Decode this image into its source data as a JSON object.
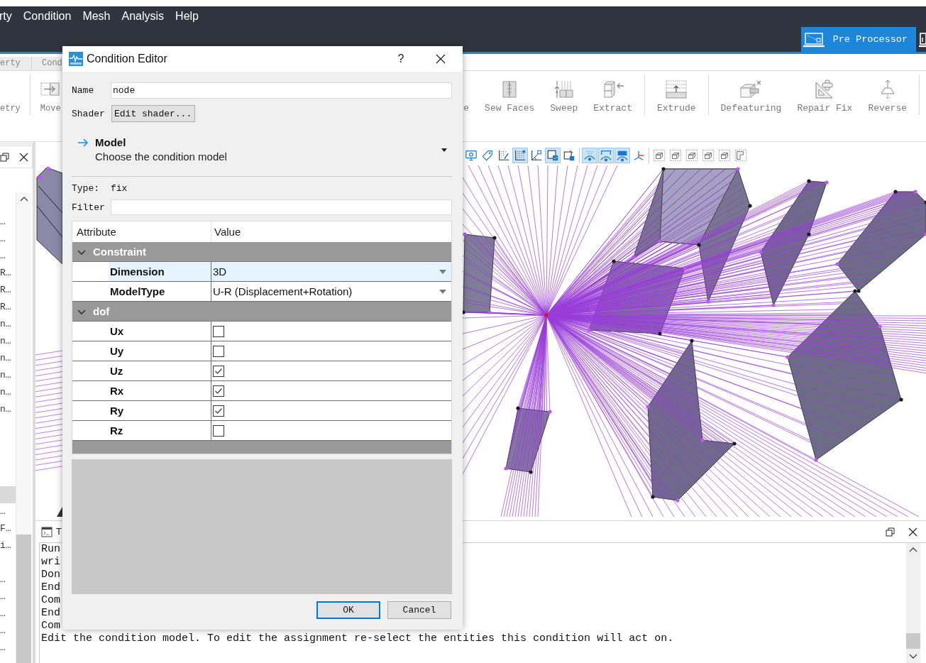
{
  "menu_bar": {
    "items": [
      "rty",
      "Condition",
      "Mesh",
      "Analysis",
      "Help"
    ]
  },
  "perspectives": [
    {
      "label": "Pre Processor",
      "selected": true
    },
    {
      "selected": false
    }
  ],
  "panel_tabs": [
    "erty",
    "Cond"
  ],
  "ribbon": {
    "left_groups": [
      [
        "etry"
      ],
      [
        "Move"
      ]
    ],
    "right_groups": [
      [
        "e",
        "Sew Faces",
        "Sweep",
        "Extract"
      ],
      [
        "Extrude"
      ],
      [
        "Defeaturing",
        "Repair Fix",
        "Reverse"
      ]
    ]
  },
  "tree_panel": {
    "rows": [
      {
        "label": "…",
        "selected": false
      },
      {
        "label": "…",
        "selected": false
      },
      {
        "label": "…",
        "selected": false
      },
      {
        "label": "R…",
        "selected": false
      },
      {
        "label": "R…",
        "selected": false
      },
      {
        "label": "R…",
        "selected": false
      },
      {
        "label": "n…",
        "selected": false
      },
      {
        "label": "n…",
        "selected": false
      },
      {
        "label": "n…",
        "selected": false
      },
      {
        "label": "n…",
        "selected": false
      },
      {
        "label": "n…",
        "selected": false
      },
      {
        "label": "n…",
        "selected": false
      },
      {
        "selected": false
      },
      {
        "selected": false
      },
      {
        "selected": false
      },
      {
        "selected": false
      },
      {
        "selected": true
      },
      {
        "label": "…",
        "selected": false
      },
      {
        "label": "F…",
        "selected": false
      },
      {
        "label": "i…",
        "selected": false
      },
      {
        "selected": false
      },
      {
        "label": "…",
        "selected": false
      },
      {
        "label": "…",
        "selected": false
      },
      {
        "label": "…",
        "selected": false
      },
      {
        "label": "…",
        "selected": false
      },
      {
        "label": "…",
        "selected": false
      }
    ]
  },
  "view_toolbar": [
    [
      {
        "on": false
      },
      {
        "on": false
      },
      {
        "on": false
      },
      {
        "on": true
      },
      {
        "on": false
      },
      {
        "on": true
      },
      {
        "on": false
      }
    ],
    [
      {
        "on": true
      },
      {
        "on": true
      },
      {
        "on": true
      },
      {
        "on": false
      }
    ],
    [
      {
        "on": false
      },
      {
        "on": false
      },
      {
        "on": false
      },
      {
        "on": false
      },
      {
        "on": false
      },
      {
        "on": false
      }
    ]
  ],
  "console": {
    "title": "T",
    "lines": [
      "Run",
      "wri",
      "Don",
      "End",
      "Com",
      "End",
      "Com",
      "Edit the condition model. To edit the assignment re-select the entities this condition will act on."
    ]
  },
  "dialog": {
    "title": "Condition Editor",
    "help_button": "?",
    "name_label": "Name",
    "name_value": "node",
    "shader_label": "Shader",
    "shader_button": "Edit shader...",
    "model": {
      "title": "Model",
      "subtitle": "Choose the condition model"
    },
    "type_label": "Type:",
    "type_value": "fix",
    "filter_label": "Filter",
    "table": {
      "columns": [
        "Attribute",
        "Value"
      ],
      "groups": [
        {
          "name": "Constraint",
          "expanded": true,
          "rows": [
            {
              "name": "Dimension",
              "kind": "combo",
              "value": "3D",
              "selected": true
            },
            {
              "name": "ModelType",
              "kind": "combo",
              "value": "U-R (Displacement+Rotation)",
              "selected": false
            }
          ]
        },
        {
          "name": "dof",
          "expanded": true,
          "rows": [
            {
              "name": "Ux",
              "kind": "checkbox",
              "checked": false,
              "selected": false
            },
            {
              "name": "Uy",
              "kind": "checkbox",
              "checked": false,
              "selected": false
            },
            {
              "name": "Uz",
              "kind": "checkbox",
              "checked": true,
              "selected": false
            },
            {
              "name": "Rx",
              "kind": "checkbox",
              "checked": true,
              "selected": false
            },
            {
              "name": "Ry",
              "kind": "checkbox",
              "checked": true,
              "selected": false
            },
            {
              "name": "Rz",
              "kind": "checkbox",
              "checked": false,
              "selected": false
            }
          ]
        }
      ]
    },
    "buttons": [
      {
        "label": "OK",
        "default": true
      },
      {
        "label": "Cancel",
        "default": false
      }
    ]
  }
}
